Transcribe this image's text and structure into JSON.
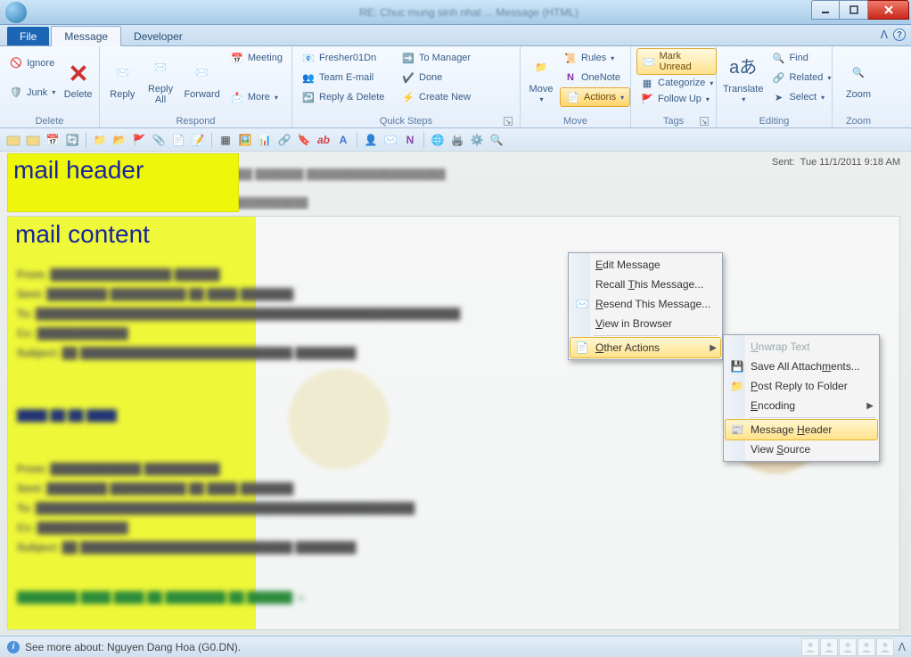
{
  "title": "RE: Chuc mung sinh nhat ... Message (HTML)",
  "tabs": {
    "file": "File",
    "message": "Message",
    "developer": "Developer"
  },
  "ribbon": {
    "delete": {
      "ignore": "Ignore",
      "junk": "Junk",
      "delete": "Delete",
      "label": "Delete"
    },
    "respond": {
      "reply": "Reply",
      "replyall": "Reply\nAll",
      "forward": "Forward",
      "meeting": "Meeting",
      "more": "More",
      "label": "Respond"
    },
    "quicksteps": {
      "a": "Fresher01Dn",
      "b": "Team E-mail",
      "c": "Reply & Delete",
      "d": "To Manager",
      "e": "Done",
      "f": "Create New",
      "label": "Quick Steps"
    },
    "move": {
      "move": "Move",
      "rules": "Rules",
      "onenote": "OneNote",
      "actions": "Actions",
      "label": "Move"
    },
    "tags": {
      "markunread": "Mark Unread",
      "categorize": "Categorize",
      "followup": "Follow Up",
      "label": "Tags"
    },
    "editing": {
      "translate": "Translate",
      "find": "Find",
      "related": "Related",
      "select": "Select",
      "label": "Editing"
    },
    "zoom": {
      "zoom": "Zoom",
      "label": "Zoom"
    }
  },
  "actions_menu": {
    "edit": "Edit Message",
    "recall": "Recall This Message...",
    "resend": "Resend This Message...",
    "browser": "View in Browser",
    "other": "Other Actions"
  },
  "other_menu": {
    "unwrap": "Unwrap Text",
    "saveatt": "Save All Attachments...",
    "postreply": "Post Reply to Folder",
    "encoding": "Encoding",
    "msgheader": "Message Header",
    "viewsrc": "View Source"
  },
  "overlay": {
    "header": "mail header",
    "content": "mail content"
  },
  "sent": {
    "label": "Sent:",
    "value": "Tue 11/1/2011 9:18 AM"
  },
  "status": "See more about: Nguyen Dang Hoa (G0.DN)."
}
